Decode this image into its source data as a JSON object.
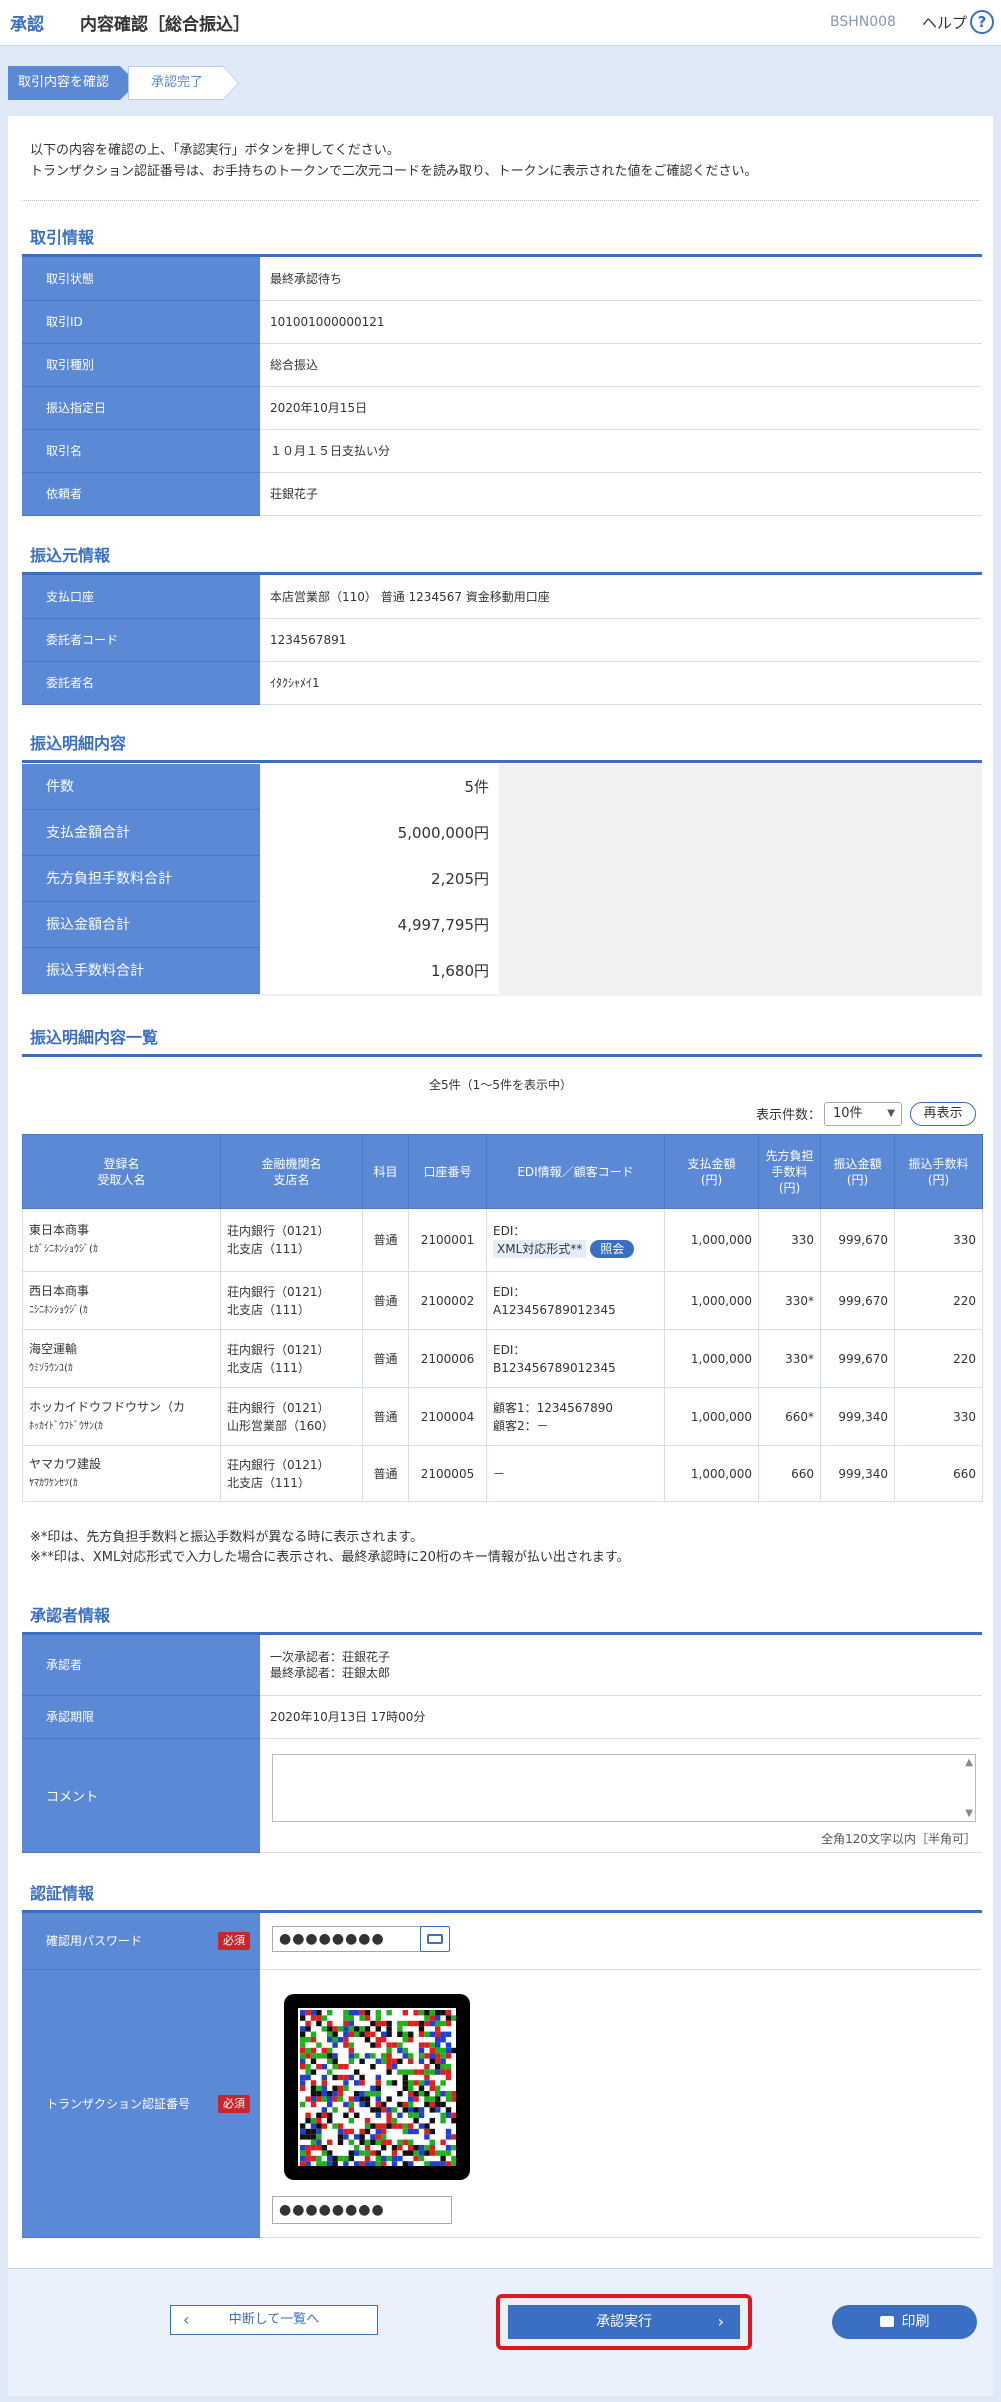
{
  "header": {
    "category": "承認",
    "title": "内容確認［総合振込］",
    "screen_code": "BSHN008",
    "help": "ヘルプ",
    "help_icon": "?"
  },
  "steps": [
    "取引内容を確認",
    "承認完了"
  ],
  "intro": [
    "以下の内容を確認の上、「承認実行」ボタンを押してください。",
    "トランザクション認証番号は、お手持ちのトークンで二次元コードを読み取り、トークンに表示された値をご確認ください。"
  ],
  "torihiki": {
    "title": "取引情報",
    "rows": [
      {
        "label": "取引状態",
        "value": "最終承認待ち"
      },
      {
        "label": "取引ID",
        "value": "101001000000121"
      },
      {
        "label": "取引種別",
        "value": "総合振込"
      },
      {
        "label": "振込指定日",
        "value": "2020年10月15日"
      },
      {
        "label": "取引名",
        "value": "１０月１５日支払い分"
      },
      {
        "label": "依頼者",
        "value": "荘銀花子"
      }
    ]
  },
  "moto": {
    "title": "振込元情報",
    "rows": [
      {
        "label": "支払口座",
        "value": "本店営業部（110） 普通 1234567 資金移動用口座"
      },
      {
        "label": "委託者コード",
        "value": "1234567891"
      },
      {
        "label": "委託者名",
        "value": "ｲﾀｸｼｬﾒｲ1"
      }
    ]
  },
  "meisai": {
    "title": "振込明細内容",
    "rows": [
      {
        "label": "件数",
        "value": "5件"
      },
      {
        "label": "支払金額合計",
        "value": "5,000,000円"
      },
      {
        "label": "先方負担手数料合計",
        "value": "2,205円"
      },
      {
        "label": "振込金額合計",
        "value": "4,997,795円"
      },
      {
        "label": "振込手数料合計",
        "value": "1,680円"
      }
    ]
  },
  "list": {
    "title": "振込明細内容一覧",
    "count_text": "全5件（1～5件を表示中）",
    "display_label": "表示件数：",
    "display_value": "10件",
    "redisplay": "再表示",
    "headers": [
      "登録名",
      "受取人名",
      "金融機関名",
      "支店名",
      "科目",
      "口座番号",
      "EDI情報／顧客コード",
      "支払金額",
      "(円)",
      "先方負担",
      "手数料",
      "(円)",
      "振込金額",
      "(円)",
      "振込手数料",
      "(円)"
    ],
    "rows": [
      {
        "name": "東日本商事",
        "kana": "ﾋｶﾞｼﾆﾎﾝｼｮｳｼﾞ(ｶ",
        "bank": "荘内銀行（0121）",
        "branch": "北支店（111）",
        "kind": "普通",
        "acct": "2100001",
        "edi1": "EDI：",
        "edi2": "XML対応形式**",
        "ref": "照会",
        "pay": "1,000,000",
        "fee": "330",
        "amt": "999,670",
        "tfee": "330"
      },
      {
        "name": "西日本商事",
        "kana": "ﾆｼﾆﾎﾝｼｮｳｼﾞ(ｶ",
        "bank": "荘内銀行（0121）",
        "branch": "北支店（111）",
        "kind": "普通",
        "acct": "2100002",
        "edi1": "EDI：",
        "edi2": "A123456789012345",
        "pay": "1,000,000",
        "fee": "330*",
        "amt": "999,670",
        "tfee": "220"
      },
      {
        "name": "海空運輸",
        "kana": "ｳﾐｿﾗｳﾝﾕ(ｶ",
        "bank": "荘内銀行（0121）",
        "branch": "北支店（111）",
        "kind": "普通",
        "acct": "2100006",
        "edi1": "EDI：",
        "edi2": "B123456789012345",
        "pay": "1,000,000",
        "fee": "330*",
        "amt": "999,670",
        "tfee": "220"
      },
      {
        "name": "ホッカイドウフドウサン（カ",
        "kana": "ﾎｯｶｲﾄﾞｳﾌﾄﾞｳｻﾝ(ｶ",
        "bank": "荘内銀行（0121）",
        "branch": "山形営業部（160）",
        "kind": "普通",
        "acct": "2100004",
        "edi1": "顧客1：1234567890",
        "edi2": "顧客2：－",
        "pay": "1,000,000",
        "fee": "660*",
        "amt": "999,340",
        "tfee": "330"
      },
      {
        "name": "ヤマカワ建設",
        "kana": "ﾔﾏｶﾜｹﾝｾﾂ(ｶ",
        "bank": "荘内銀行（0121）",
        "branch": "北支店（111）",
        "kind": "普通",
        "acct": "2100005",
        "edi1": "－",
        "edi2": "",
        "pay": "1,000,000",
        "fee": "660",
        "amt": "999,340",
        "tfee": "660"
      }
    ],
    "notes": [
      "※*印は、先方負担手数料と振込手数料が異なる時に表示されます。",
      "※**印は、XML対応形式で入力した場合に表示され、最終承認時に20桁のキー情報が払い出されます。"
    ]
  },
  "shoninsha": {
    "title": "承認者情報",
    "approver_label": "承認者",
    "approver1": "一次承認者：荘銀花子",
    "approver2": "最終承認者：荘銀太郎",
    "deadline_label": "承認期限",
    "deadline": "2020年10月13日 17時00分",
    "comment_label": "コメント",
    "comment_hint": "全角120文字以内［半角可］"
  },
  "ninsho": {
    "title": "認証情報",
    "password_label": "確認用パスワード",
    "required": "必須",
    "password_value": "●●●●●●●●",
    "token_label": "トランザクション認証番号",
    "token_value": "●●●●●●●●"
  },
  "buttons": {
    "back": "中断して一覧へ",
    "approve": "承認実行",
    "print": "印刷"
  },
  "colors": {
    "accent": "#3a6fc4",
    "header_cell": "#5b89d6",
    "highlight": "#e2141f",
    "required": "#c7262d"
  }
}
